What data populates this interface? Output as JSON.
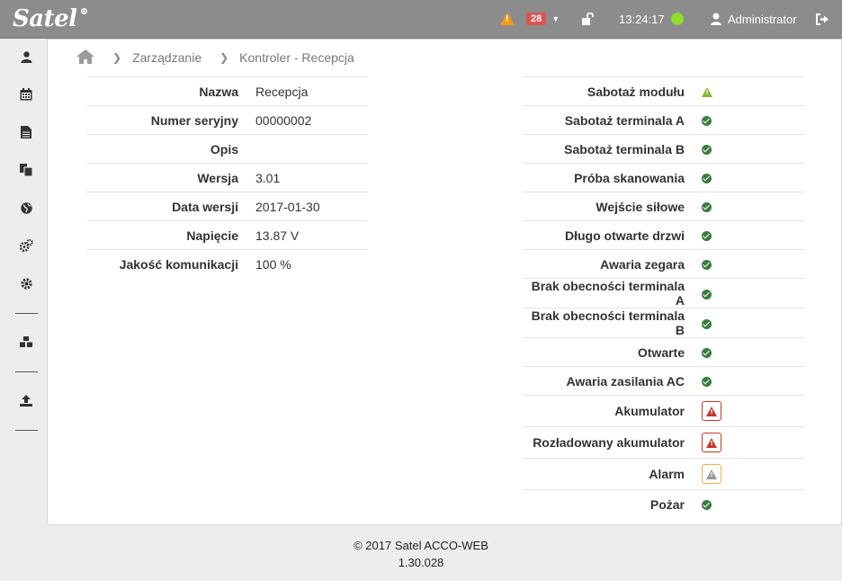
{
  "header": {
    "logo": "Satel",
    "alert_count": "28",
    "time": "13:24:17",
    "user": "Administrator",
    "status_color": "#8fdd2f"
  },
  "sidebar": {
    "icons": [
      "user-icon",
      "calendar-icon",
      "document-icon",
      "documents-copy-icon",
      "globe-icon",
      "cogs-icon",
      "gear-icon",
      "cubes-icon",
      "upload-icon"
    ]
  },
  "breadcrumb": {
    "items": [
      "Zarządzanie",
      "Kontroler - Recepcja"
    ]
  },
  "info": [
    {
      "label": "Nazwa",
      "value": "Recepcja"
    },
    {
      "label": "Numer seryjny",
      "value": "00000002"
    },
    {
      "label": "Opis",
      "value": ""
    },
    {
      "label": "Wersja",
      "value": "3.01"
    },
    {
      "label": "Data wersji",
      "value": "2017-01-30"
    },
    {
      "label": "Napięcie",
      "value": "13.87 V"
    },
    {
      "label": "Jakość komunikacji",
      "value": "100 %"
    }
  ],
  "status": [
    {
      "label": "Sabotaż modułu",
      "state": "warning-green"
    },
    {
      "label": "Sabotaż terminala A",
      "state": "ok"
    },
    {
      "label": "Sabotaż terminala B",
      "state": "ok"
    },
    {
      "label": "Próba skanowania",
      "state": "ok"
    },
    {
      "label": "Wejście siłowe",
      "state": "ok"
    },
    {
      "label": "Długo otwarte drzwi",
      "state": "ok"
    },
    {
      "label": "Awaria zegara",
      "state": "ok"
    },
    {
      "label": "Brak obecności terminala A",
      "state": "ok"
    },
    {
      "label": "Brak obecności terminala B",
      "state": "ok"
    },
    {
      "label": "Otwarte",
      "state": "ok"
    },
    {
      "label": "Awaria zasilania AC",
      "state": "ok"
    },
    {
      "label": "Akumulator",
      "state": "alarm-red"
    },
    {
      "label": "Rozładowany akumulator",
      "state": "alarm-red"
    },
    {
      "label": "Alarm",
      "state": "alarm-grey"
    },
    {
      "label": "Pożar",
      "state": "ok"
    }
  ],
  "footer": {
    "copyright": "© 2017 Satel",
    "product": "ACCO-WEB",
    "version": "1.30.028"
  }
}
